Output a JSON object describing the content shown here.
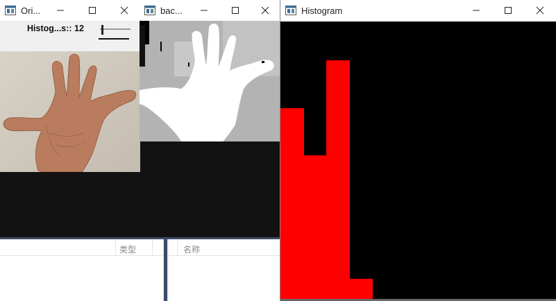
{
  "windows": {
    "original": {
      "title": "Ori...",
      "trackbar_label": "Histog...s:: 12"
    },
    "background": {
      "title": "bac..."
    },
    "histogram": {
      "title": "Histogram"
    }
  },
  "explorer": {
    "columns": [
      "类型",
      "名称"
    ]
  },
  "chart_data": {
    "type": "bar",
    "values": [
      69,
      52,
      86,
      8
    ],
    "bar_color": "#ff0000",
    "background_color": "#000000"
  },
  "colors": {
    "histogram_bar": "#ff0000",
    "histogram_bg": "#000000",
    "desktop_bg": "#121212",
    "explorer_accent": "#3b4a67"
  },
  "icons": {
    "window_icon": "opencv-window-icon",
    "minimize": "minimize-icon",
    "maximize": "maximize-icon",
    "close": "close-icon"
  }
}
